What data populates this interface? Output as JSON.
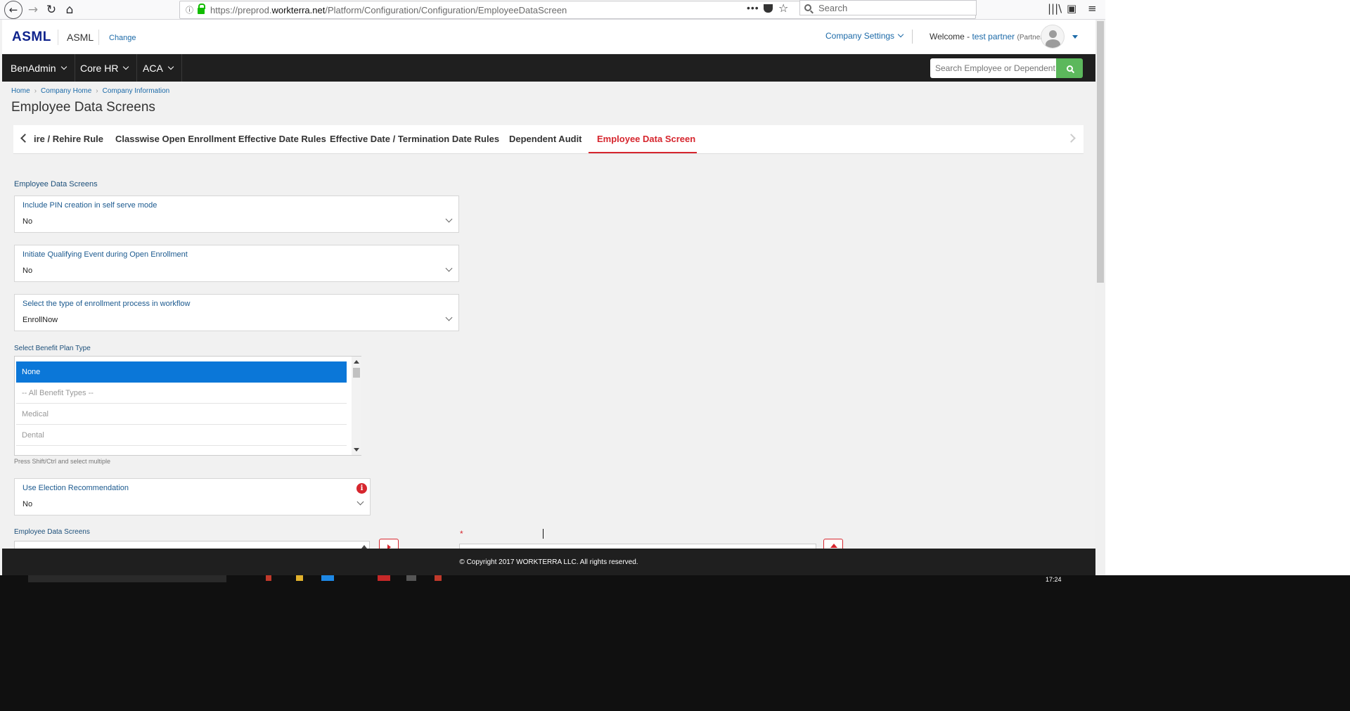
{
  "browser": {
    "url_prefix": "https://preprod.",
    "url_domain": "workterra.net",
    "url_path": "/Platform/Configuration/Configuration/EmployeeDataScreen",
    "search_placeholder": "Search",
    "dots": "•••"
  },
  "header": {
    "logo": "ASML",
    "company_name": "ASML",
    "change_link": "Change",
    "company_settings": "Company Settings",
    "welcome_prefix": "Welcome - ",
    "user_name": "test partner",
    "user_role": "(Partner)"
  },
  "menu": {
    "items": [
      {
        "label": "BenAdmin"
      },
      {
        "label": "Core HR"
      },
      {
        "label": "ACA"
      }
    ],
    "search_placeholder": "Search Employee or Dependent"
  },
  "breadcrumb": {
    "items": [
      "Home",
      "Company Home",
      "Company Information"
    ]
  },
  "page": {
    "title": "Employee Data Screens"
  },
  "tabs": {
    "items": [
      {
        "label": "ire / Rehire Rule"
      },
      {
        "label": "Classwise Open Enrollment Effective Date Rules"
      },
      {
        "label": "Effective Date / Termination Date Rules"
      },
      {
        "label": "Dependent Audit"
      },
      {
        "label": "Employee Data Screen"
      }
    ],
    "active_index": 4
  },
  "form": {
    "section_title": "Employee Data Screens",
    "fields": [
      {
        "label": "Include PIN creation in self serve mode",
        "value": "No"
      },
      {
        "label": "Initiate Qualifying Event during Open Enrollment",
        "value": "No"
      },
      {
        "label": "Select the type of enrollment process in workflow",
        "value": "EnrollNow"
      }
    ],
    "benefit_plan_label": "Select Benefit Plan Type",
    "benefit_plan_options": [
      "None",
      "-- All Benefit Types --",
      "Medical",
      "Dental"
    ],
    "benefit_plan_selected": "None",
    "multi_select_hint": "Press Shift/Ctrl and select multiple",
    "election_label": "Use Election Recommendation",
    "election_value": "No",
    "info_glyph": "i",
    "bottom_section_title": "Employee Data Screens",
    "required_mark": "*"
  },
  "footer": {
    "copyright": "© Copyright 2017 WORKTERRA LLC. All rights reserved."
  },
  "taskbar": {
    "time": "17:24"
  },
  "colors": {
    "accent_red": "#d6262e",
    "link_blue": "#1c6aa8",
    "menu_bg": "#1f1f1f",
    "selected_blue": "#0b77d8",
    "search_green": "#5cb85c",
    "logo_blue": "#0f238c"
  }
}
